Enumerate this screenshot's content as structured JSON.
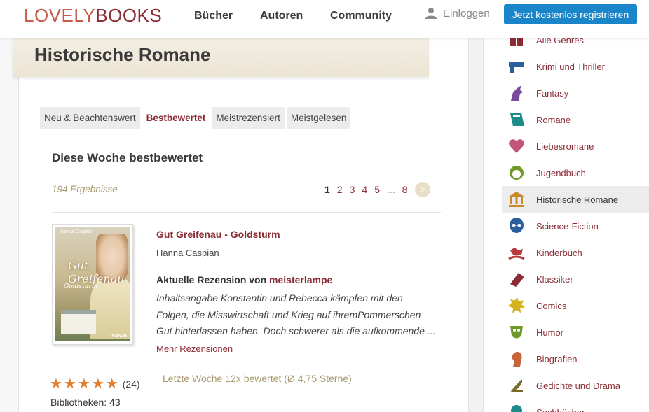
{
  "header": {
    "logo_lovely": "LOVELY",
    "logo_books": "BOOKS",
    "nav": [
      "Bücher",
      "Autoren",
      "Community"
    ],
    "login": "Einloggen",
    "register": "Jetzt kostenlos registrieren"
  },
  "page": {
    "title": "Historische Romane",
    "tabs": [
      "Neu & Beachtenswert",
      "Bestbewertet",
      "Meistrezensiert",
      "Meistgelesen"
    ],
    "active_tab": "Bestbewertet",
    "section_title": "Diese Woche bestbewertet",
    "results": "194 Ergebnisse",
    "pager": {
      "pages": [
        "1",
        "2",
        "3",
        "4",
        "5"
      ],
      "dots": "...",
      "last": "8",
      "next": ">",
      "current": "1"
    }
  },
  "book": {
    "title": "Gut Greifenau - Goldsturm",
    "author": "Hanna Caspian",
    "cover": {
      "author": "Hanna Caspian",
      "title": "Gut Greifenau",
      "subtitle": "Goldsturm",
      "publisher": "KNAUR"
    },
    "review_prefix": "Aktuelle Rezension von",
    "review_user": "meisterlampe",
    "review_text": "Inhaltsangabe Konstantin und Rebecca kämpfen mit den Folgen, die Misswirtschaft und Krieg auf ihremPommerschen Gut hinterlassen haben. Doch schwerer als die aufkommende ...",
    "more_reviews": "Mehr Rezensionen",
    "stars": 5,
    "ratings_count": "(24)",
    "libraries": "Bibliotheken: 43",
    "last_week": "Letzte Woche 12x bewertet (Ø 4,75 Sterne)"
  },
  "sidebar": {
    "genres": [
      {
        "label": "Alle Genres",
        "icon": "gift-icon",
        "color": "#8b2b34"
      },
      {
        "label": "Krimi und Thriller",
        "icon": "gun-icon",
        "color": "#2a5f9e"
      },
      {
        "label": "Fantasy",
        "icon": "unicorn-icon",
        "color": "#7a4a9a"
      },
      {
        "label": "Romane",
        "icon": "book-icon",
        "color": "#1e8a8a"
      },
      {
        "label": "Liebesromane",
        "icon": "heart-icon",
        "color": "#c2557a"
      },
      {
        "label": "Jugendbuch",
        "icon": "kid-icon",
        "color": "#6f9a2a"
      },
      {
        "label": "Historische Romane",
        "icon": "temple-icon",
        "color": "#c88a2a"
      },
      {
        "label": "Science-Fiction",
        "icon": "alien-icon",
        "color": "#2a5f9e"
      },
      {
        "label": "Kinderbuch",
        "icon": "rocking-horse-icon",
        "color": "#b83a3a"
      },
      {
        "label": "Klassiker",
        "icon": "scroll-icon",
        "color": "#8b2b34"
      },
      {
        "label": "Comics",
        "icon": "pow-icon",
        "color": "#d6b21e"
      },
      {
        "label": "Humor",
        "icon": "mask-icon",
        "color": "#6f9a2a"
      },
      {
        "label": "Biografien",
        "icon": "silhouette-icon",
        "color": "#c8643a"
      },
      {
        "label": "Gedichte und Drama",
        "icon": "quill-icon",
        "color": "#7a6a2a"
      },
      {
        "label": "Sachbücher",
        "icon": "bulb-icon",
        "color": "#1e8a8a"
      }
    ],
    "active": "Historische Romane"
  }
}
